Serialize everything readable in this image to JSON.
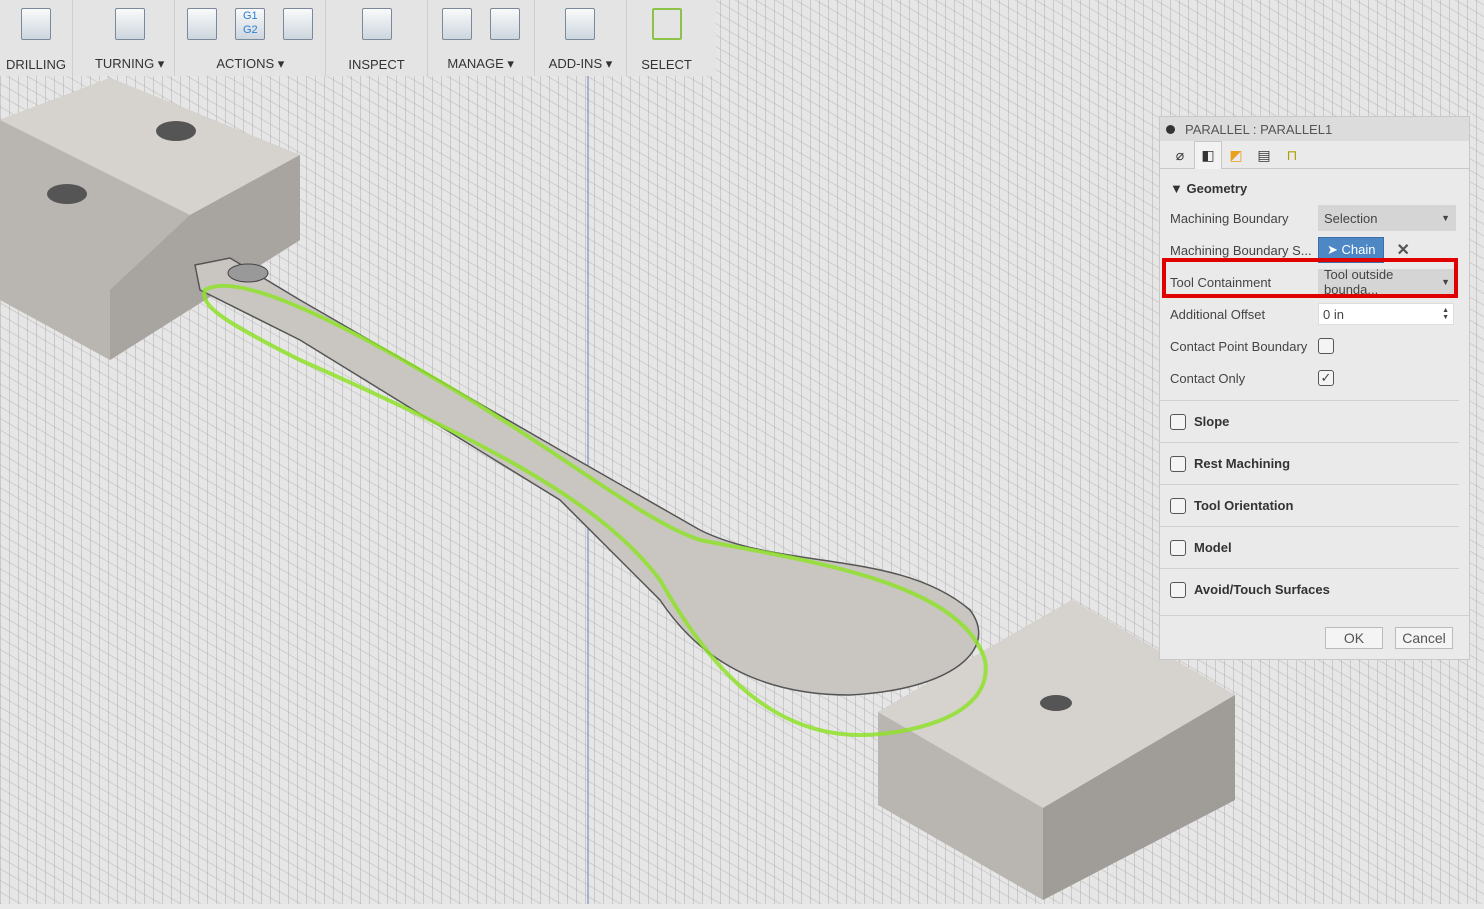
{
  "toolbar": {
    "groups": [
      {
        "label": "DRILLING",
        "icons": [
          "drill-icon"
        ]
      },
      {
        "label": "TURNING ▾",
        "icons": [
          "turning-icon"
        ]
      },
      {
        "label": "ACTIONS ▾",
        "icons": [
          "simulate-icon",
          "post-process-icon",
          "setup-sheet-icon"
        ],
        "gcode": "G1\nG2"
      },
      {
        "label": "INSPECT",
        "icons": [
          "measure-icon"
        ]
      },
      {
        "label": "MANAGE ▾",
        "icons": [
          "tool-library-icon",
          "task-manager-icon"
        ]
      },
      {
        "label": "ADD-INS ▾",
        "icons": [
          "scripts-icon"
        ]
      },
      {
        "label": "SELECT",
        "icons": [
          "select-icon"
        ]
      }
    ]
  },
  "panel": {
    "title": "PARALLEL : PARALLEL1",
    "section": "▼ Geometry",
    "rows": {
      "boundary": {
        "label": "Machining Boundary",
        "value": "Selection"
      },
      "boundary_sel": {
        "label": "Machining Boundary S...",
        "value": "Chain"
      },
      "containment": {
        "label": "Tool Containment",
        "value": "Tool outside bounda..."
      },
      "offset": {
        "label": "Additional Offset",
        "value": "0 in"
      },
      "contact_point": {
        "label": "Contact Point Boundary",
        "checked": false
      },
      "contact_only": {
        "label": "Contact Only",
        "checked": true
      }
    },
    "groups": [
      "Slope",
      "Rest Machining",
      "Tool Orientation",
      "Model",
      "Avoid/Touch Surfaces"
    ],
    "ok": "OK",
    "cancel": "Cancel"
  },
  "colors": {
    "highlight": "#e00000",
    "toolpath": "#8fe02a",
    "chain": "#4d88c4"
  }
}
